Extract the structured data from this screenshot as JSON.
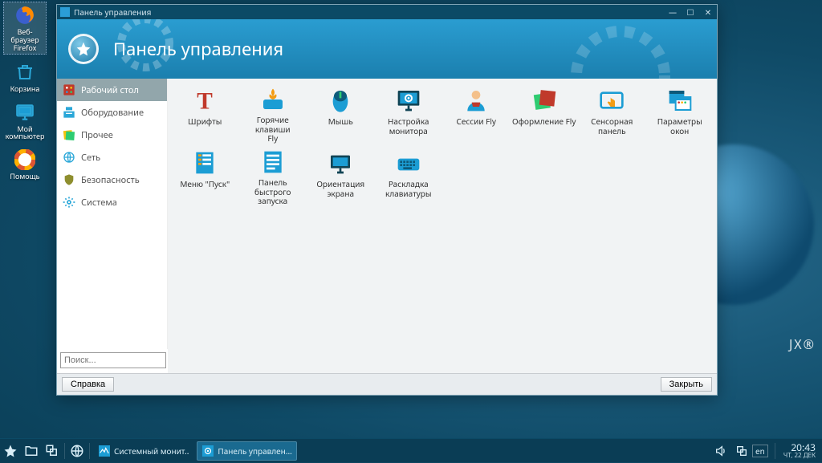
{
  "desktop_icons": [
    {
      "id": "firefox",
      "label": "Веб-браузер\nFirefox",
      "selected": true,
      "color": "#ff8a00"
    },
    {
      "id": "trash",
      "label": "Корзина",
      "selected": false,
      "color": "#2aa7d8"
    },
    {
      "id": "computer",
      "label": "Мой\nкомпьютер",
      "selected": false,
      "color": "#2aa7d8"
    },
    {
      "id": "help",
      "label": "Помощь",
      "selected": false,
      "color": "#ffb000"
    }
  ],
  "wallpaper_mark": "JX®",
  "window": {
    "title": "Панель управления",
    "heading": "Панель управления",
    "categories": [
      {
        "id": "desktop",
        "label": "Рабочий стол",
        "active": true
      },
      {
        "id": "hardware",
        "label": "Оборудование",
        "active": false
      },
      {
        "id": "other",
        "label": "Прочее",
        "active": false
      },
      {
        "id": "network",
        "label": "Сеть",
        "active": false
      },
      {
        "id": "security",
        "label": "Безопасность",
        "active": false
      },
      {
        "id": "system",
        "label": "Система",
        "active": false
      }
    ],
    "items": [
      {
        "id": "fonts",
        "label": "Шрифты"
      },
      {
        "id": "hotkeys",
        "label": "Горячие клавиши\nFly"
      },
      {
        "id": "mouse",
        "label": "Мышь"
      },
      {
        "id": "monitor",
        "label": "Настройка\nмонитора"
      },
      {
        "id": "sessions",
        "label": "Сессии Fly"
      },
      {
        "id": "theme",
        "label": "Оформление Fly"
      },
      {
        "id": "touch",
        "label": "Сенсорная\nпанель"
      },
      {
        "id": "winparams",
        "label": "Параметры окон"
      },
      {
        "id": "startmenu",
        "label": "Меню \"Пуск\""
      },
      {
        "id": "quicklaunch",
        "label": "Панель быстрого\nзапуска"
      },
      {
        "id": "orientation",
        "label": "Ориентация\nэкрана"
      },
      {
        "id": "keyboard",
        "label": "Раскладка\nклавиатуры"
      }
    ],
    "search_placeholder": "Поиск...",
    "help_button": "Справка",
    "close_button": "Закрыть"
  },
  "taskbar": {
    "tasks": [
      {
        "id": "sysmon",
        "label": "Системный монит..",
        "active": false
      },
      {
        "id": "panel",
        "label": "Панель управлен...",
        "active": true
      }
    ],
    "lang": "en",
    "time": "20:43",
    "date": "ЧТ, 22 ДЕК"
  }
}
